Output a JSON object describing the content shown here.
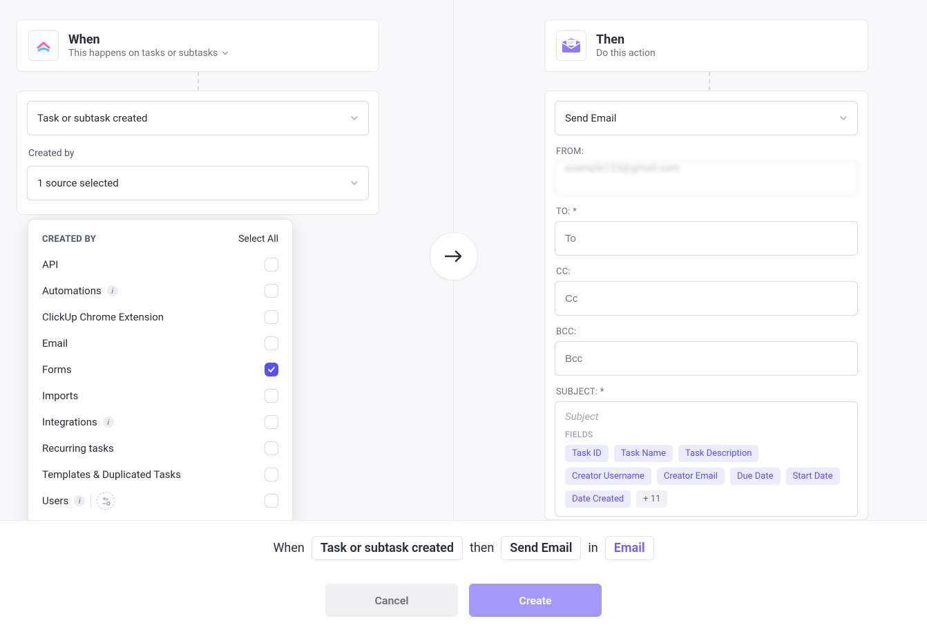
{
  "trigger": {
    "title": "When",
    "subtitle": "This happens on tasks or subtasks",
    "selected": "Task or subtask created",
    "created_by_label": "Created by",
    "source_summary": "1 source selected"
  },
  "popover": {
    "title": "CREATED BY",
    "select_all": "Select All",
    "options": [
      {
        "label": "API",
        "checked": false,
        "info": false
      },
      {
        "label": "Automations",
        "checked": false,
        "info": true
      },
      {
        "label": "ClickUp Chrome Extension",
        "checked": false,
        "info": false
      },
      {
        "label": "Email",
        "checked": false,
        "info": false
      },
      {
        "label": "Forms",
        "checked": true,
        "info": false
      },
      {
        "label": "Imports",
        "checked": false,
        "info": false
      },
      {
        "label": "Integrations",
        "checked": false,
        "info": true
      },
      {
        "label": "Recurring tasks",
        "checked": false,
        "info": false
      },
      {
        "label": "Templates & Duplicated Tasks",
        "checked": false,
        "info": false
      },
      {
        "label": "Users",
        "checked": false,
        "info": true,
        "users_row": true
      }
    ]
  },
  "action": {
    "title": "Then",
    "subtitle": "Do this action",
    "selected": "Send Email",
    "from_label": "FROM:",
    "from_value": "example123@gmail.com",
    "to_label": "TO: *",
    "to_placeholder": "To",
    "cc_label": "CC:",
    "cc_placeholder": "Cc",
    "bcc_label": "BCC:",
    "bcc_placeholder": "Bcc",
    "subject_label": "SUBJECT: *",
    "subject_placeholder": "Subject",
    "fields_label": "FIELDS",
    "fields": [
      "Task ID",
      "Task Name",
      "Task Description",
      "Creator Username",
      "Creator Email",
      "Due Date",
      "Start Date",
      "Date Created"
    ],
    "fields_more": "+ 11"
  },
  "summary": {
    "when_word": "When",
    "trigger_token": "Task or subtask created",
    "then_word": "then",
    "action_token": "Send Email",
    "in_word": "in",
    "location": "Email"
  },
  "buttons": {
    "cancel": "Cancel",
    "create": "Create"
  },
  "colors": {
    "accent": "#5c4dff",
    "chip_bg": "#edecff"
  }
}
